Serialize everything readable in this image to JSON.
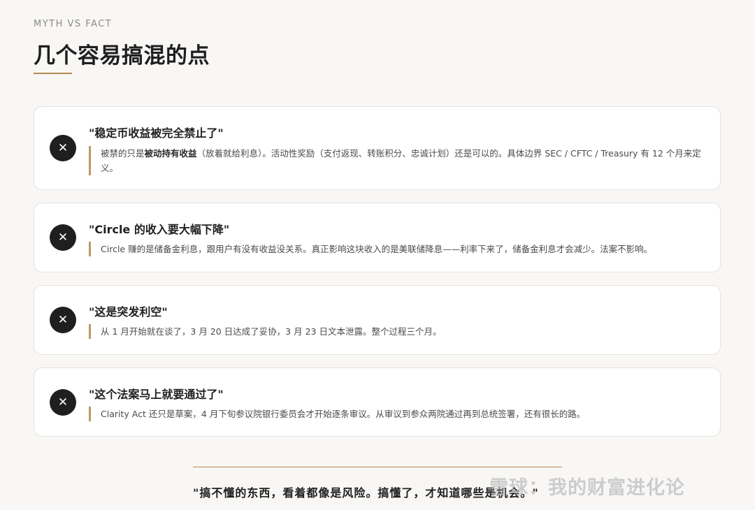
{
  "header": {
    "eyebrow": "MYTH VS FACT",
    "title": "几个容易搞混的点"
  },
  "cards": [
    {
      "myth": "\"稳定币收益被完全禁止了\"",
      "fact_prefix": "被禁的只是",
      "fact_bold": "被动持有收益",
      "fact_suffix": "（放着就给利息）。活动性奖励（支付返现、转账积分、忠诚计划）还是可以的。具体边界 SEC / CFTC / Treasury 有 12 个月来定义。"
    },
    {
      "myth": "\"Circle 的收入要大幅下降\"",
      "fact": "Circle 赚的是储备金利息，跟用户有没有收益没关系。真正影响这块收入的是美联储降息——利率下来了，储备金利息才会减少。法案不影响。"
    },
    {
      "myth": "\"这是突发利空\"",
      "fact": "从 1 月开始就在谈了，3 月 20 日达成了妥协，3 月 23 日文本泄露。整个过程三个月。"
    },
    {
      "myth": "\"这个法案马上就要通过了\"",
      "fact": "Clarity Act 还只是草案，4 月下旬参议院银行委员会才开始逐条审议。从审议到参众两院通过再到总统签署，还有很长的路。"
    }
  ],
  "icons": {
    "myth_badge": "close-x-icon",
    "myth_badge_glyph": "✕"
  },
  "footer": {
    "quote": "\"搞不懂的东西，看着都像是风险。搞懂了，才知道哪些是机会。\"",
    "watermark": "雪球：我的财富进化论"
  },
  "colors": {
    "accent": "#b38c4f",
    "background": "#f8f7f5",
    "badge": "#1f1f1f"
  }
}
